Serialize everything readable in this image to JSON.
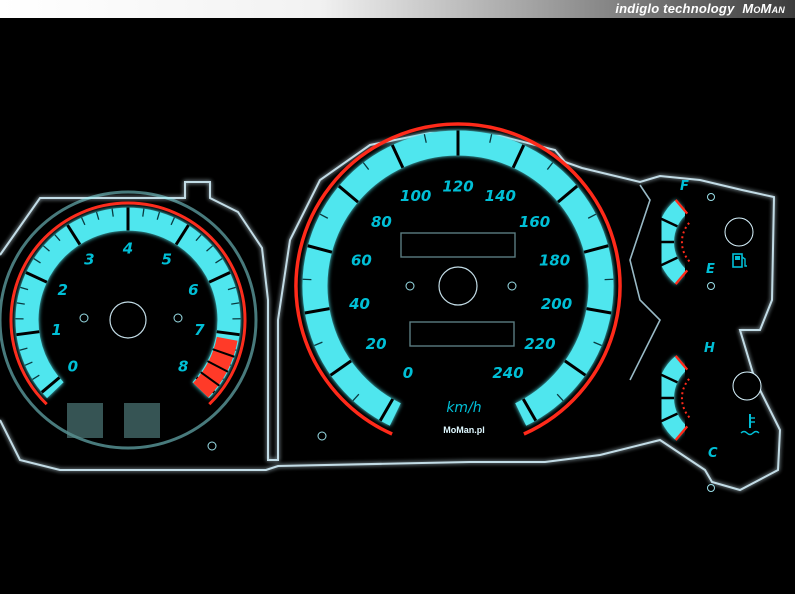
{
  "banner": {
    "tagline": "indiglo technology",
    "brand": "MoMan"
  },
  "tachometer": {
    "labels": [
      "0",
      "1",
      "2",
      "3",
      "4",
      "5",
      "6",
      "7",
      "8"
    ]
  },
  "speedometer": {
    "labels": [
      "0",
      "20",
      "40",
      "60",
      "80",
      "100",
      "120",
      "140",
      "160",
      "180",
      "200",
      "220",
      "240"
    ],
    "unit": "km/h",
    "maker": "MoMan.pl"
  },
  "fuel_gauge": {
    "full": "F",
    "empty": "E",
    "icon": "fuel-pump-icon"
  },
  "temp_gauge": {
    "hot": "H",
    "cold": "C",
    "icon": "coolant-temperature-icon"
  },
  "colors": {
    "glow": "#4fe6ee",
    "ring": "#ff2a1a",
    "panel_edge": "#d8f4ff",
    "text": "#00bfd6"
  }
}
